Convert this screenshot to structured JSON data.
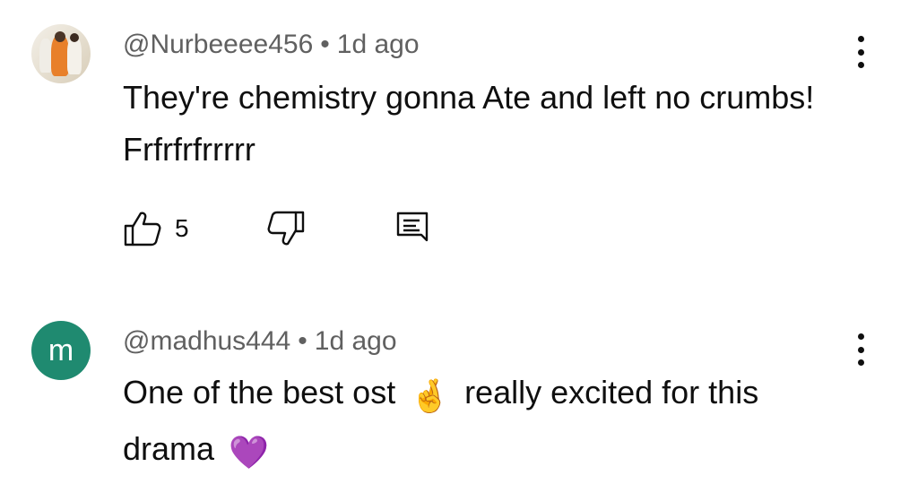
{
  "comments": [
    {
      "username": "@Nurbeeee456",
      "time": "1d ago",
      "text": "They're  chemistry gonna Ate and left no crumbs! Frfrfrfrrrrr",
      "likes": "5",
      "avatar_icon": "photo-avatar"
    },
    {
      "username": "@madhus444",
      "time": "1d ago",
      "avatar_letter": "m",
      "avatar_color": "#1f8a70",
      "text_part1": "One of the best ost",
      "emoji1": "🤞",
      "text_part2": "really excited for this drama",
      "emoji2": "💜"
    }
  ],
  "separator": "•",
  "icons": {
    "more": "more-vert-icon",
    "like": "thumb-up-icon",
    "dislike": "thumb-down-icon",
    "reply": "reply-comment-icon"
  }
}
